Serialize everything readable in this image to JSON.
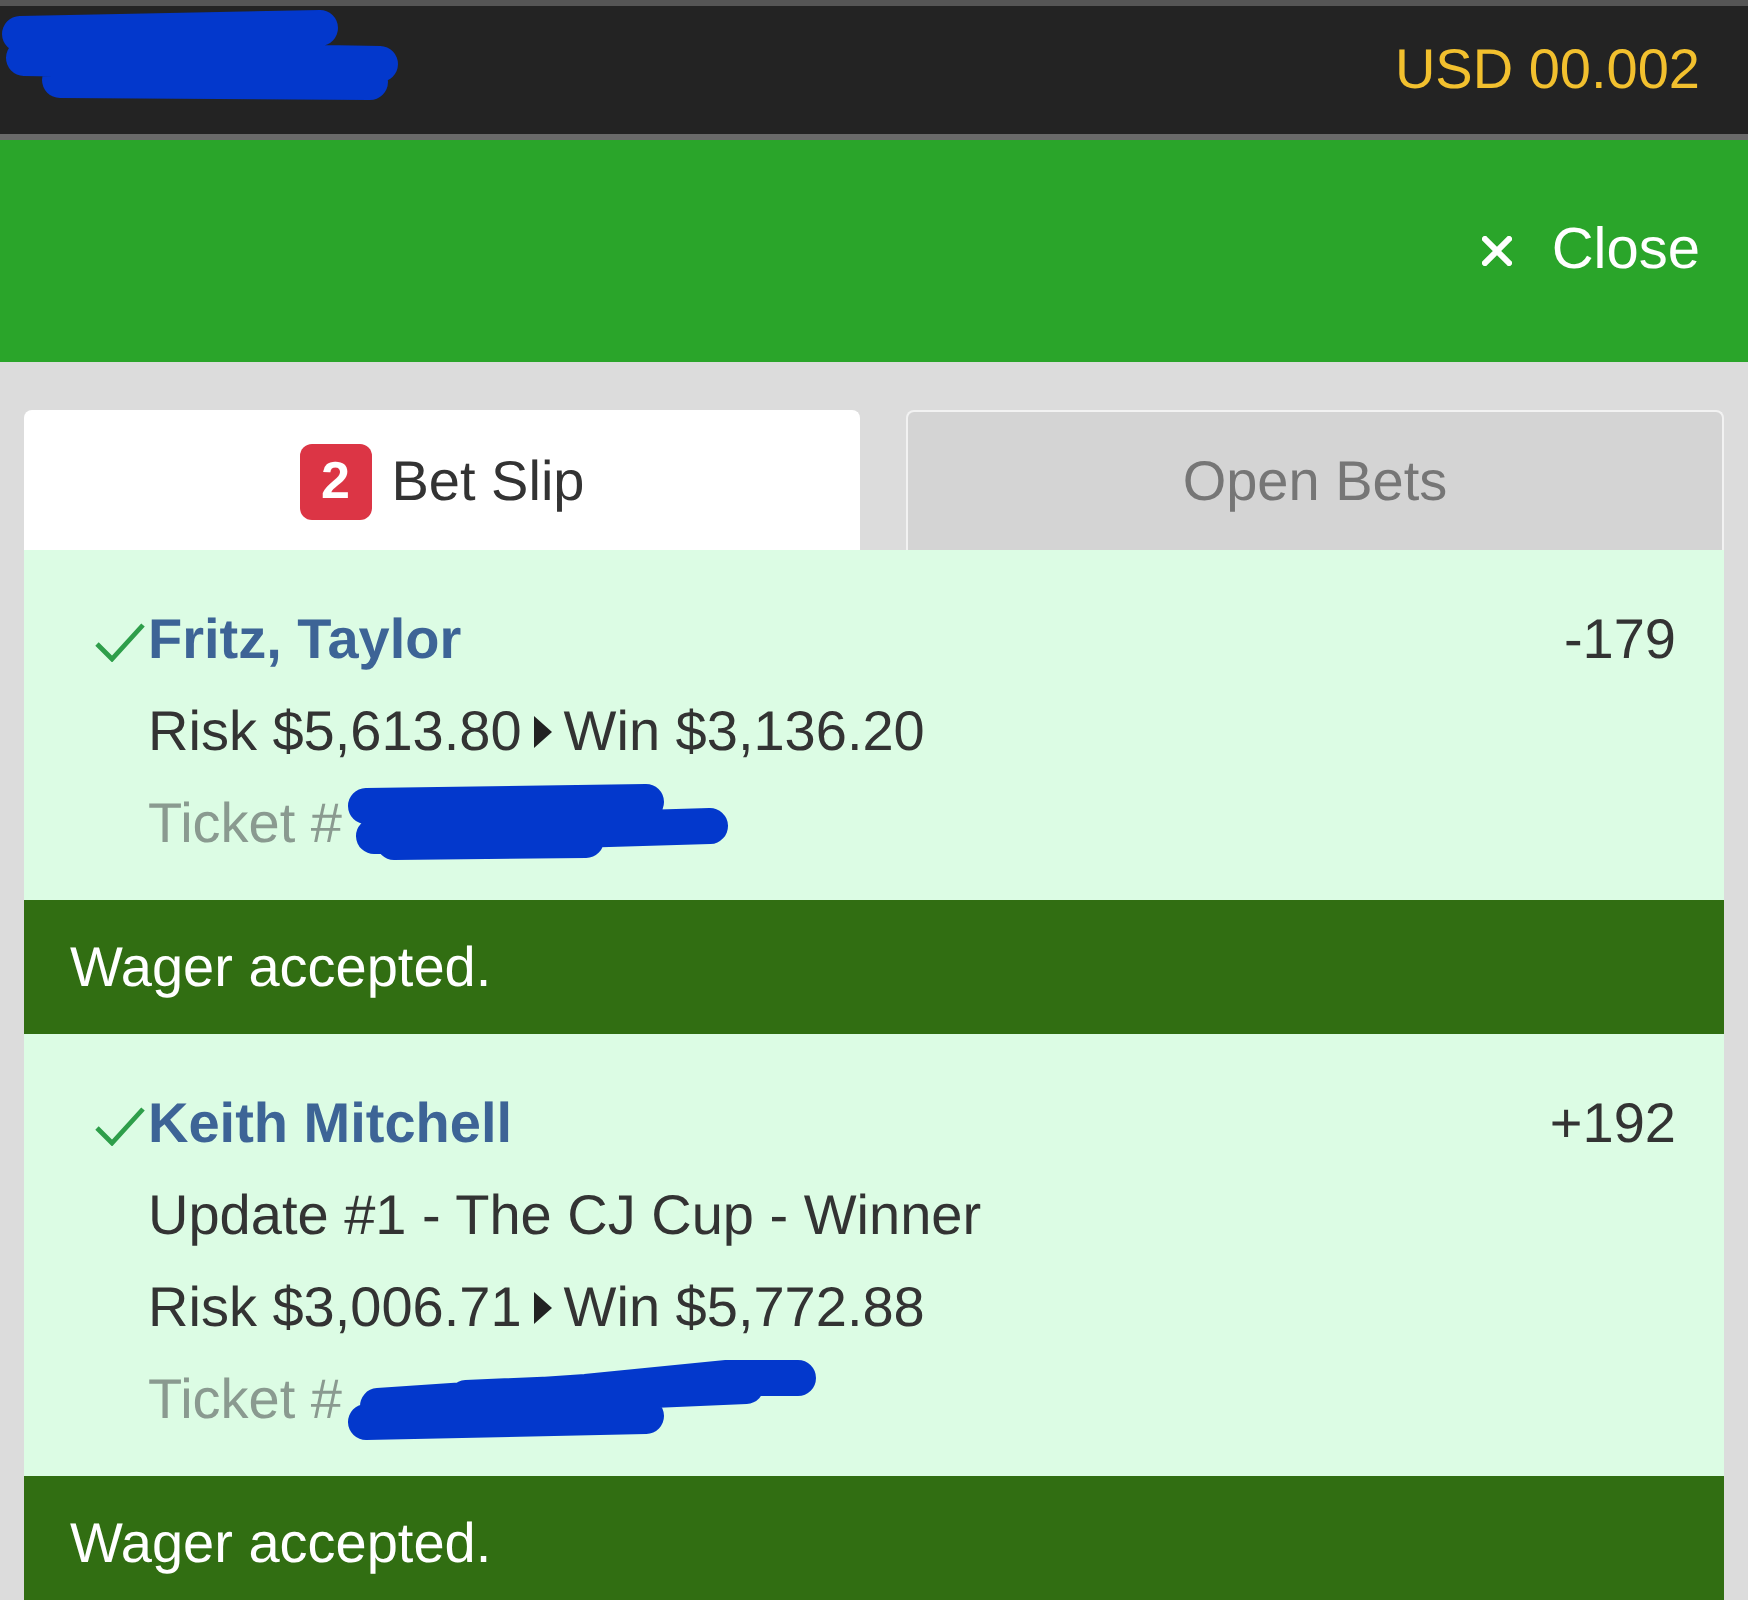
{
  "top_bar": {
    "balance": "USD 00.002"
  },
  "header": {
    "close_button": {
      "label": "Close"
    }
  },
  "tabs": [
    {
      "label": "Bet Slip",
      "badge": "2",
      "selected": true
    },
    {
      "label": "Open Bets",
      "selected": false
    }
  ],
  "bets": [
    {
      "confirmed": true,
      "selection": "Fritz, Taylor",
      "odds": "-179",
      "risk": "Risk $5,613.80",
      "win": "Win $3,136.20",
      "ticket_label": "Ticket #",
      "status": "Wager accepted."
    },
    {
      "confirmed": true,
      "selection": "Keith Mitchell",
      "odds": "+192",
      "description": "Update #1 - The CJ Cup - Winner",
      "risk": "Risk $3,006.71",
      "win": "Win $5,772.88",
      "ticket_label": "Ticket #",
      "status": "Wager accepted."
    }
  ]
}
